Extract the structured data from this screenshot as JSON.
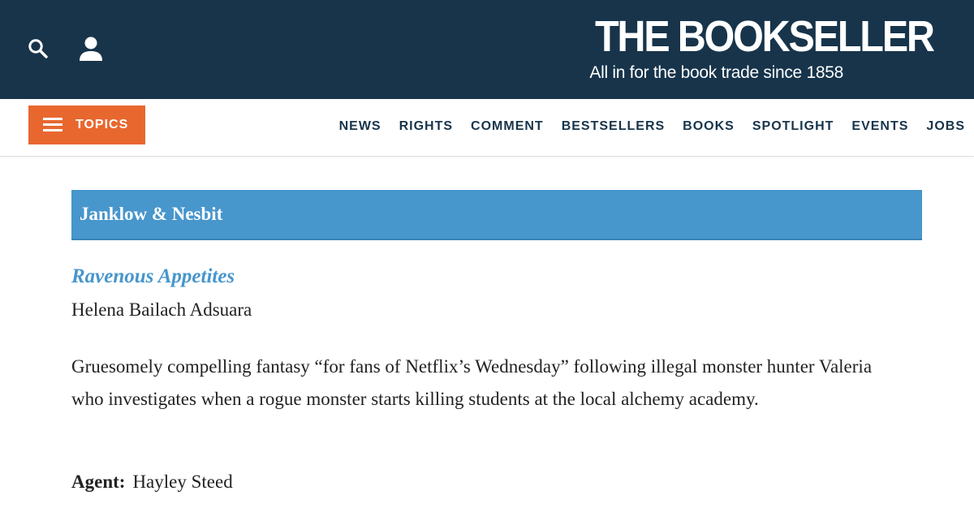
{
  "header": {
    "brand_name": "THE BOOKSELLER",
    "tagline": "All in for the book trade since 1858",
    "icons": [
      "search-icon",
      "account-icon"
    ]
  },
  "nav": {
    "topics_label": "TOPICS",
    "links": [
      "NEWS",
      "RIGHTS",
      "COMMENT",
      "BESTSELLERS",
      "BOOKS",
      "SPOTLIGHT",
      "EVENTS",
      "JOBS"
    ]
  },
  "article": {
    "section_title": "Janklow & Nesbit",
    "book_title": "Ravenous Appetites",
    "author": "Helena Bailach Adsuara",
    "description": "Gruesomely compelling fantasy “for fans of Netflix’s Wednesday” following illegal monster hunter Valeria who investigates when a rogue monster starts killing students at the local alchemy academy.",
    "agent_label": "Agent:",
    "agent_name": "Hayley Steed"
  },
  "colors": {
    "header_bg": "#17344b",
    "topics_button": "#e8672f",
    "section_bar": "#4796cc",
    "title_link": "#4796cc"
  }
}
